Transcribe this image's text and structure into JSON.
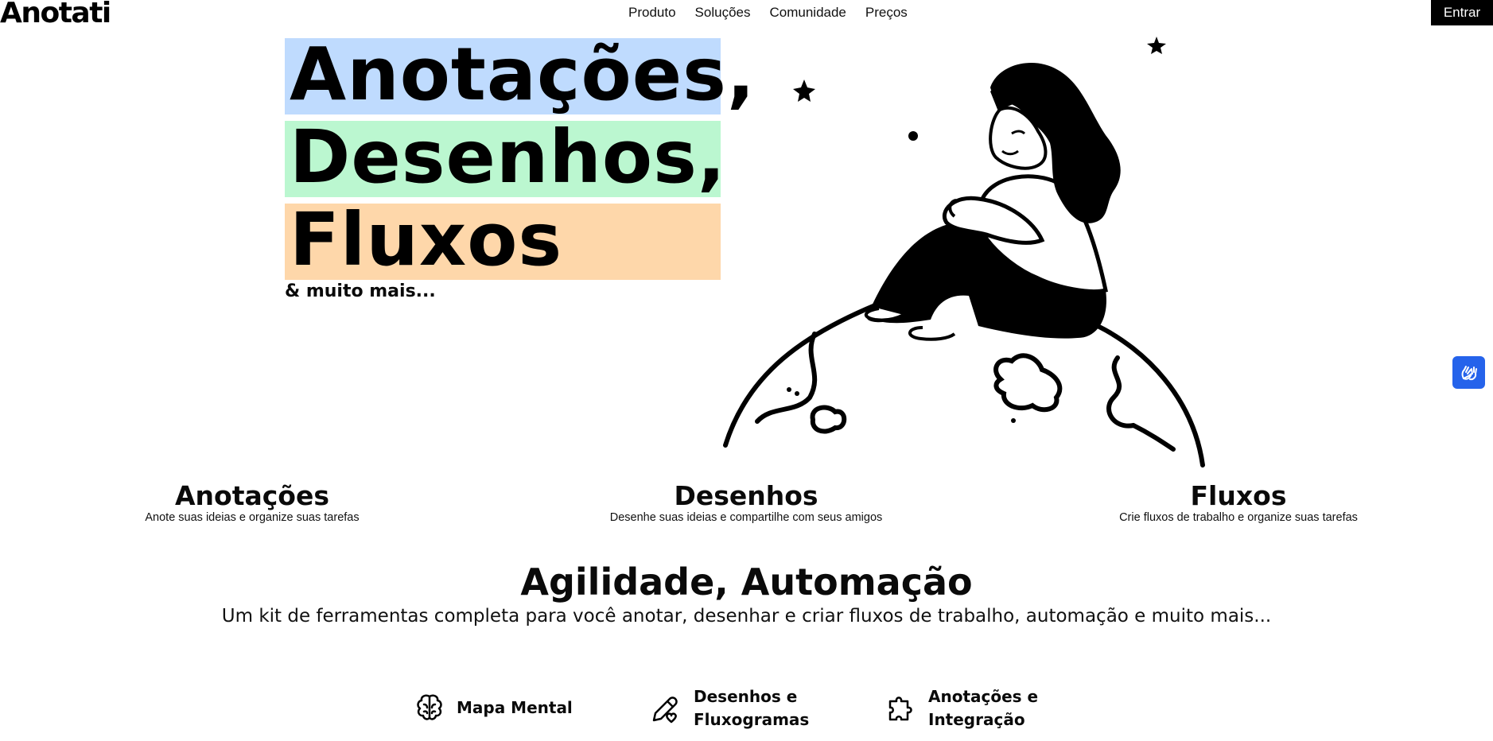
{
  "header": {
    "logo": "Anotati",
    "nav": [
      "Produto",
      "Soluções",
      "Comunidade",
      "Preços"
    ],
    "login_label": "Entrar"
  },
  "hero": {
    "words": [
      "Anotações,",
      "Desenhos,",
      "Fluxos"
    ],
    "band_colors": [
      "#bfdbfe",
      "#bbf7d0",
      "#fed7aa"
    ],
    "tagline": "& muito mais..."
  },
  "features": [
    {
      "title": "Anotações",
      "desc": "Anote suas ideias e organize suas tarefas"
    },
    {
      "title": "Desenhos",
      "desc": "Desenhe suas ideias e compartilhe com seus amigos"
    },
    {
      "title": "Fluxos",
      "desc": "Crie fluxos de trabalho e organize suas tarefas"
    }
  ],
  "section": {
    "title": "Agilidade, Automação",
    "subtitle": "Um kit de ferramentas completa para você anotar, desenhar e criar fluxos de trabalho, automação e muito mais..."
  },
  "tools": [
    {
      "label": "Mapa Mental",
      "icon": "brain-icon"
    },
    {
      "label": "Desenhos e Fluxogramas",
      "icon": "pencil-heart-icon"
    },
    {
      "label": "Anotações e Integração",
      "icon": "puzzle-icon"
    }
  ],
  "accessibility": {
    "icon": "sign-language-hands-icon",
    "color": "#2563eb"
  }
}
